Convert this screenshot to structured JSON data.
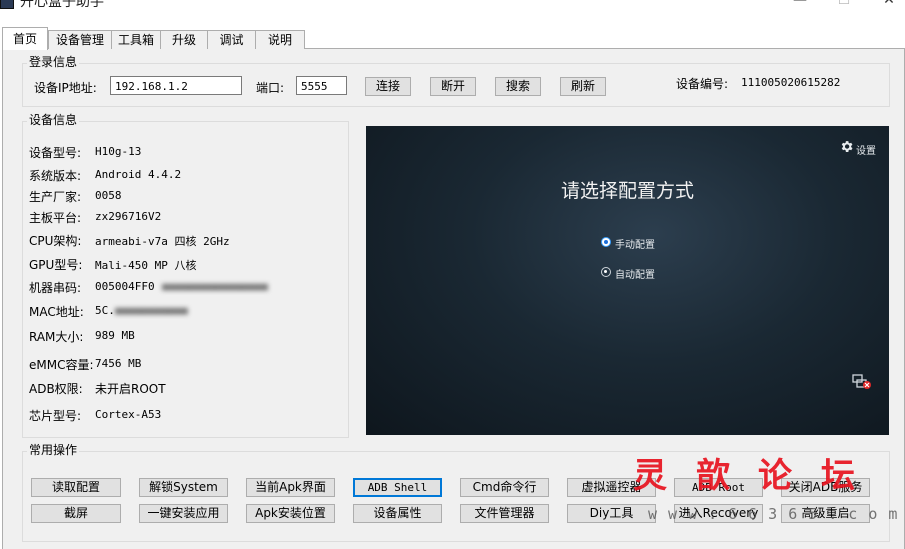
{
  "window": {
    "title": "开心盒子助手",
    "minimize": "—",
    "maximize": "☐",
    "close": "✕"
  },
  "tabs": [
    "首页",
    "设备管理",
    "工具箱",
    "升级",
    "调试",
    "说明"
  ],
  "login": {
    "group_title": "登录信息",
    "ip_label": "设备IP地址:",
    "ip_value": "192.168.1.2",
    "port_label": "端口:",
    "port_value": "5555",
    "buttons": {
      "connect": "连接",
      "disconnect": "断开",
      "search": "搜索",
      "refresh": "刷新"
    },
    "device_no_label": "设备编号:",
    "device_no_value": "111005020615282"
  },
  "device_info": {
    "group_title": "设备信息",
    "rows": [
      {
        "label": "设备型号:",
        "value": "H10g-13"
      },
      {
        "label": "系统版本:",
        "value": "Android 4.4.2"
      },
      {
        "label": "生产厂家:",
        "value": "0058"
      },
      {
        "label": "主板平台:",
        "value": "zx296716V2"
      },
      {
        "label": "CPU架构:",
        "value": "armeabi-v7a 四核 2GHz"
      },
      {
        "label": "GPU型号:",
        "value": "Mali-450 MP 八核"
      },
      {
        "label": "机器串码:",
        "value": "005004FF0"
      },
      {
        "label": "MAC地址:",
        "value": "5C."
      },
      {
        "label": "RAM大小:",
        "value": "989 MB"
      },
      {
        "label": "eMMC容量:",
        "value": "7456 MB"
      },
      {
        "label": "ADB权限:",
        "value": "未开启ROOT"
      },
      {
        "label": "芯片型号:",
        "value": "Cortex-A53"
      }
    ]
  },
  "screen": {
    "settings_label": "设置",
    "title": "请选择配置方式",
    "options": [
      "手动配置",
      "自动配置"
    ]
  },
  "common_ops": {
    "group_title": "常用操作",
    "row1": [
      "读取配置",
      "解锁System",
      "当前Apk界面",
      "ADB Shell",
      "Cmd命令行",
      "虚拟遥控器",
      "ADB Root",
      "关闭ADB服务"
    ],
    "row2": [
      "截屏",
      "一键安装应用",
      "Apk安装位置",
      "设备属性",
      "文件管理器",
      "Diy工具",
      "进入Recovery",
      "高级重启"
    ]
  },
  "watermark": {
    "chars": [
      "灵",
      "歆",
      "论",
      "坛"
    ],
    "url": "www.66365.com"
  },
  "colors": {
    "accent": "#0078d7",
    "watermark": "#e8131f",
    "screen_bg": "#1a2833"
  }
}
